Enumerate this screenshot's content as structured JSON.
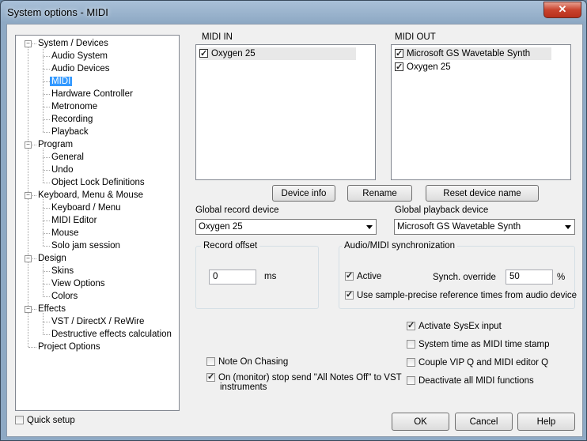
{
  "window": {
    "title": "System options - MIDI",
    "close_glyph": "✕"
  },
  "tree": [
    {
      "label": "System / Devices",
      "level": 0,
      "expander": "−"
    },
    {
      "label": "Audio System",
      "level": 1
    },
    {
      "label": "Audio Devices",
      "level": 1
    },
    {
      "label": "MIDI",
      "level": 1,
      "selected": true
    },
    {
      "label": "Hardware Controller",
      "level": 1
    },
    {
      "label": "Metronome",
      "level": 1
    },
    {
      "label": "Recording",
      "level": 1
    },
    {
      "label": "Playback",
      "level": 1
    },
    {
      "label": "Program",
      "level": 0,
      "expander": "−"
    },
    {
      "label": "General",
      "level": 1
    },
    {
      "label": "Undo",
      "level": 1
    },
    {
      "label": "Object Lock Definitions",
      "level": 1
    },
    {
      "label": "Keyboard, Menu & Mouse",
      "level": 0,
      "expander": "−"
    },
    {
      "label": "Keyboard / Menu",
      "level": 1
    },
    {
      "label": "MIDI Editor",
      "level": 1
    },
    {
      "label": "Mouse",
      "level": 1
    },
    {
      "label": "Solo jam session",
      "level": 1
    },
    {
      "label": "Design",
      "level": 0,
      "expander": "−"
    },
    {
      "label": "Skins",
      "level": 1
    },
    {
      "label": "View Options",
      "level": 1
    },
    {
      "label": "Colors",
      "level": 1
    },
    {
      "label": "Effects",
      "level": 0,
      "expander": "−"
    },
    {
      "label": "VST / DirectX / ReWire",
      "level": 1
    },
    {
      "label": "Destructive effects calculation",
      "level": 1
    },
    {
      "label": "Project Options",
      "level": 0
    }
  ],
  "quick_setup": {
    "label": "Quick setup",
    "checked": false
  },
  "midi_in": {
    "label": "MIDI IN",
    "items": [
      {
        "name": "Oxygen 25",
        "checked": true,
        "highlight": true
      }
    ]
  },
  "midi_out": {
    "label": "MIDI OUT",
    "items": [
      {
        "name": "Microsoft GS Wavetable Synth",
        "checked": true,
        "highlight": true
      },
      {
        "name": "Oxygen 25",
        "checked": true,
        "highlight": false
      }
    ]
  },
  "buttons": {
    "device_info": "Device info",
    "rename": "Rename",
    "reset": "Reset device name",
    "ok": "OK",
    "cancel": "Cancel",
    "help": "Help"
  },
  "record_device": {
    "label": "Global record device",
    "value": "Oxygen 25"
  },
  "playback_device": {
    "label": "Global playback device",
    "value": "Microsoft GS Wavetable Synth"
  },
  "record_offset": {
    "title": "Record offset",
    "value": "0",
    "unit": "ms"
  },
  "sync": {
    "title": "Audio/MIDI synchronization",
    "active_label": "Active",
    "active_checked": true,
    "override_label": "Synch. override",
    "override_value": "50",
    "override_unit": "%",
    "sample_precise_label": "Use sample-precise reference times from audio device",
    "sample_precise_checked": true
  },
  "options_right": [
    {
      "label": "Activate SysEx input",
      "checked": true
    },
    {
      "label": "System time as MIDI time stamp",
      "checked": false
    },
    {
      "label": "Couple VIP Q and MIDI editor Q",
      "checked": false
    },
    {
      "label": "Deactivate all MIDI functions",
      "checked": false
    }
  ],
  "options_left": {
    "note_on_chasing": {
      "label": "Note On Chasing",
      "checked": false
    },
    "all_notes_off": {
      "label_line1": "On (monitor) stop send \"All Notes Off\" to VST",
      "label_line2": "instruments",
      "checked": true
    }
  }
}
